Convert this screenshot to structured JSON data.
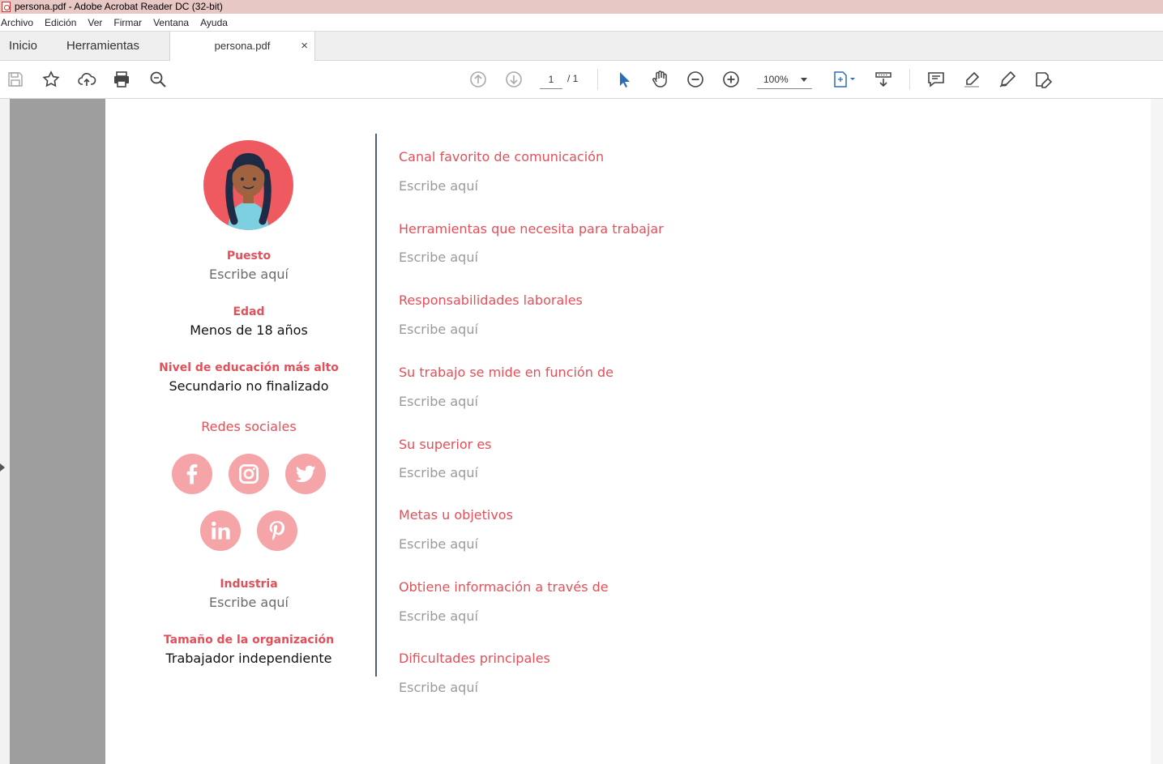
{
  "window": {
    "title": "persona.pdf - Adobe Acrobat Reader DC (32-bit)"
  },
  "menu": [
    "Archivo",
    "Edición",
    "Ver",
    "Firmar",
    "Ventana",
    "Ayuda"
  ],
  "tabs": {
    "home": "Inicio",
    "tools": "Herramientas",
    "document": "persona.pdf",
    "close": "×"
  },
  "toolbar": {
    "page_current": "1",
    "page_total": "/ 1",
    "zoom": "100%"
  },
  "persona": {
    "left": {
      "puesto_label": "Puesto",
      "puesto_value": "Escribe aquí",
      "edad_label": "Edad",
      "edad_value": "Menos de 18 años",
      "educacion_label": "Nivel de educación más alto",
      "educacion_value": "Secundario no finalizado",
      "redes_label": "Redes sociales",
      "social_icons": [
        "facebook-icon",
        "instagram-icon",
        "twitter-icon",
        "linkedin-icon",
        "pinterest-icon"
      ],
      "industria_label": "Industria",
      "industria_value": "Escribe aquí",
      "tamano_label": "Tamaño de la organización",
      "tamano_value": "Trabajador independiente"
    },
    "right": [
      {
        "label": "Canal favorito de comunicación",
        "value": "Escribe aquí"
      },
      {
        "label": "Herramientas que necesita para trabajar",
        "value": "Escribe aquí"
      },
      {
        "label": "Responsabilidades laborales",
        "value": "Escribe aquí"
      },
      {
        "label": "Su trabajo se mide en función de",
        "value": "Escribe aquí"
      },
      {
        "label": "Su superior es",
        "value": "Escribe aquí"
      },
      {
        "label": "Metas u objetivos",
        "value": "Escribe aquí"
      },
      {
        "label": "Obtiene información a través de",
        "value": "Escribe aquí"
      },
      {
        "label": "Dificultades principales",
        "value": "Escribe aquí"
      }
    ]
  },
  "colors": {
    "accent": "#e2505a",
    "avatar_bg": "#ef5a60",
    "social_bg": "#f5a4a8",
    "divider": "#4a5b84",
    "placeholder": "#9a9a9a"
  }
}
